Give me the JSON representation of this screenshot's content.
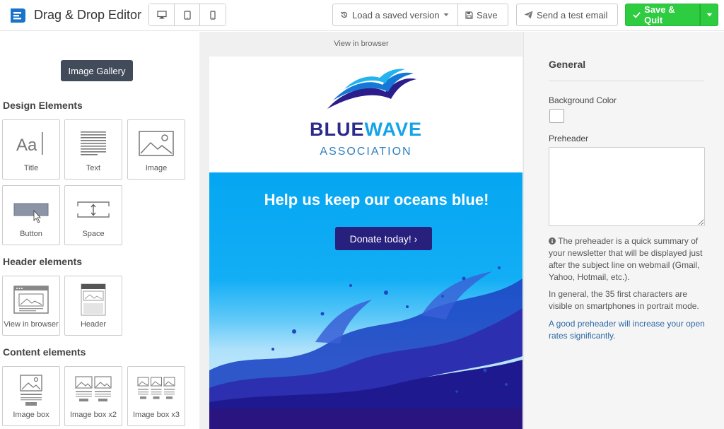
{
  "toolbar": {
    "app_title": "Drag & Drop Editor",
    "devices": [
      "desktop-icon",
      "tablet-icon",
      "mobile-icon"
    ],
    "load_label": "Load a saved version",
    "save_label": "Save",
    "test_label": "Send a test email",
    "quit_label": "Save & Quit",
    "accent": "#2ecc40"
  },
  "left": {
    "gallery_label": "Image Gallery",
    "design_heading": "Design Elements",
    "design_items": [
      {
        "label": "Title",
        "icon": "title-icon"
      },
      {
        "label": "Text",
        "icon": "text-lines-icon"
      },
      {
        "label": "Image",
        "icon": "image-icon"
      },
      {
        "label": "Button",
        "icon": "button-icon"
      },
      {
        "label": "Space",
        "icon": "space-icon"
      }
    ],
    "header_heading": "Header elements",
    "header_items": [
      {
        "label": "View in browser",
        "icon": "browser-window-icon"
      },
      {
        "label": "Header",
        "icon": "header-layout-icon"
      }
    ],
    "content_heading": "Content elements",
    "content_items": [
      {
        "label": "Image box",
        "icon": "image-box-icon"
      },
      {
        "label": "Image box x2",
        "icon": "image-box-x2-icon"
      },
      {
        "label": "Image box x3",
        "icon": "image-box-x3-icon"
      }
    ]
  },
  "preview": {
    "view_in_browser": "View in browser",
    "brand_part1": "BLUE",
    "brand_part2": "WAVE",
    "brand_sub": "ASSOCIATION",
    "hero_title": "Help us keep our oceans blue!",
    "donate_label": "Donate today! ›"
  },
  "right": {
    "general_heading": "General",
    "bg_color_label": "Background Color",
    "bg_color_value": "#ffffff",
    "preheader_label": "Preheader",
    "preheader_value": "",
    "info_text": "The preheader is a quick summary of your newsletter that will be displayed just after the subject line on webmail (Gmail, Yahoo, Hotmail, etc.).",
    "chars_text": "In general, the 35 first characters are visible on smartphones in portrait mode.",
    "tip_text": "A good preheader will increase your open rates significantly."
  }
}
